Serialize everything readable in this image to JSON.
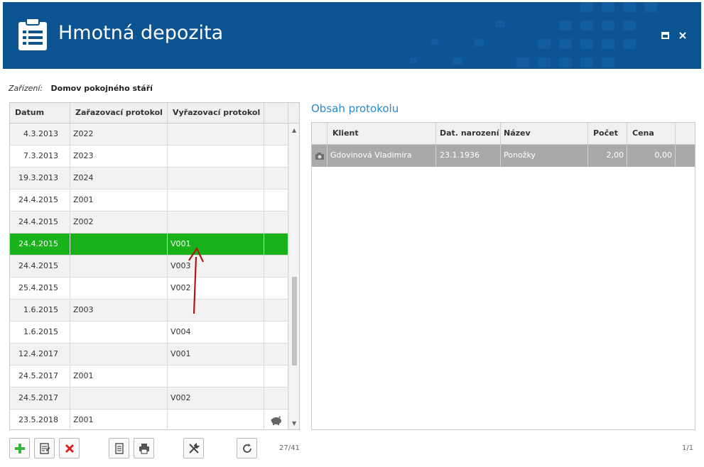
{
  "window": {
    "title": "Hmotná depozita",
    "accent": "#0c5392",
    "selected_row_color": "#1ab21a"
  },
  "device": {
    "label": "Zařízení:",
    "value": "Domov pokojného stáří"
  },
  "protocols_table": {
    "headers": [
      "Datum",
      "Zařazovací protokol",
      "Vyřazovací protokol"
    ],
    "rows": [
      {
        "date": "4.3.2013",
        "zar": "Z022",
        "vyr": ""
      },
      {
        "date": "7.3.2013",
        "zar": "Z023",
        "vyr": ""
      },
      {
        "date": "19.3.2013",
        "zar": "Z024",
        "vyr": ""
      },
      {
        "date": "24.4.2015",
        "zar": "Z001",
        "vyr": ""
      },
      {
        "date": "24.4.2015",
        "zar": "Z002",
        "vyr": ""
      },
      {
        "date": "24.4.2015",
        "zar": "",
        "vyr": "V001"
      },
      {
        "date": "24.4.2015",
        "zar": "",
        "vyr": "V003"
      },
      {
        "date": "25.4.2015",
        "zar": "",
        "vyr": "V002"
      },
      {
        "date": "1.6.2015",
        "zar": "Z003",
        "vyr": ""
      },
      {
        "date": "1.6.2015",
        "zar": "",
        "vyr": "V004"
      },
      {
        "date": "12.4.2017",
        "zar": "",
        "vyr": "V001"
      },
      {
        "date": "24.5.2017",
        "zar": "Z001",
        "vyr": ""
      },
      {
        "date": "24.5.2017",
        "zar": "",
        "vyr": "V002"
      },
      {
        "date": "23.5.2018",
        "zar": "Z001",
        "vyr": ""
      }
    ],
    "selected_index": 5,
    "last_row_icon": "piggy-bank-icon",
    "counter": "27/41"
  },
  "contents": {
    "title": "Obsah protokolu",
    "headers": [
      "Klient",
      "Dat. narození",
      "Název",
      "Počet",
      "Cena"
    ],
    "rows": [
      {
        "icon": "camera-icon",
        "klient": "Gdovinová Vladimíra",
        "datum": "23.1.1936",
        "nazev": "Ponožky",
        "pocet": "2,00",
        "cena": "0,00"
      }
    ],
    "counter": "1/1"
  },
  "toolbar": {
    "buttons": [
      "add-icon",
      "edit-icon",
      "delete-icon",
      "document-icon",
      "print-icon",
      "tools-icon",
      "refresh-icon"
    ]
  }
}
